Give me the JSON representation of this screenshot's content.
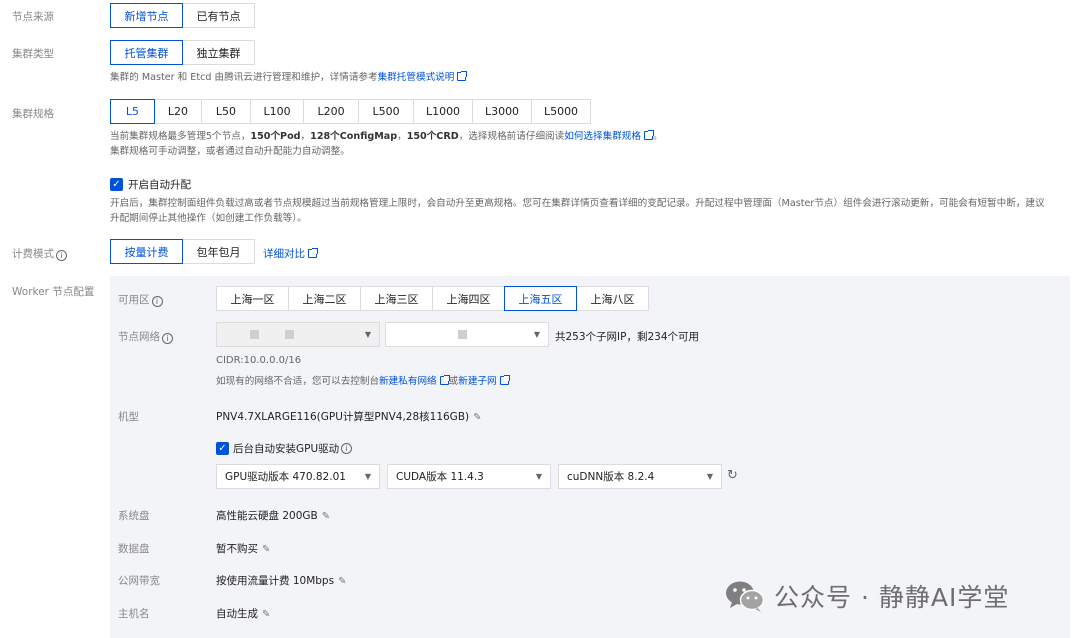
{
  "node_source": {
    "label": "节点来源",
    "options": [
      "新增节点",
      "已有节点"
    ],
    "selected": 0
  },
  "cluster_type": {
    "label": "集群类型",
    "options": [
      "托管集群",
      "独立集群"
    ],
    "selected": 0,
    "tip_prefix": "集群的 Master 和 Etcd 由腾讯云进行管理和维护，详情请参考",
    "tip_link": "集群托管模式说明"
  },
  "cluster_spec": {
    "label": "集群规格",
    "options": [
      "L5",
      "L20",
      "L50",
      "L100",
      "L200",
      "L500",
      "L1000",
      "L3000",
      "L5000"
    ],
    "selected": 0,
    "tip1_a": "当前集群规格最多管理5个节点，",
    "tip1_b1": "150个Pod",
    "tip1_sep1": "，",
    "tip1_b2": "128个ConfigMap",
    "tip1_sep2": "，",
    "tip1_b3": "150个CRD",
    "tip1_c": "，选择规格前请仔细阅读",
    "tip1_link": "如何选择集群规格",
    "tip1_end": "。",
    "tip2": "集群规格可手动调整，或者通过自动升配能力自动调整。",
    "auto_upgrade_label": "开启自动升配",
    "auto_upgrade_desc1": "开启后，集群控制面组件负载过高或者节点规模超过当前规格管理上限时，会自动升至更高规格。您可在集群详情页查看详细的变配记录。升配过程中管理面（Master节点）组件会进行滚动更新，可能会有短暂中断，建议",
    "auto_upgrade_desc2": "升配期间停止其他操作（如创建工作负载等）。"
  },
  "billing": {
    "label": "计费模式",
    "options": [
      "按量计费",
      "包年包月"
    ],
    "selected": 0,
    "compare_link": "详细对比"
  },
  "worker": {
    "label": "Worker 节点配置",
    "zone": {
      "label": "可用区",
      "options": [
        "上海一区",
        "上海二区",
        "上海三区",
        "上海四区",
        "上海五区",
        "上海八区"
      ],
      "selected": 4
    },
    "network": {
      "label": "节点网络",
      "subnet_info": "共253个子网IP，剩234个可用",
      "cidr": "CIDR:10.0.0.0/16",
      "hint_prefix": "如现有的网络不合适，您可以去控制台",
      "link_vpc": "新建私有网络",
      "hint_or": "或",
      "link_subnet": "新建子网"
    },
    "model": {
      "label": "机型",
      "value": "PNV4.7XLARGE116(GPU计算型PNV4,28核116GB)"
    },
    "gpu": {
      "auto_install_label": "后台自动安装GPU驱动",
      "driver": "GPU驱动版本 470.82.01",
      "cuda": "CUDA版本 11.4.3",
      "cudnn": "cuDNN版本 8.2.4"
    },
    "system_disk": {
      "label": "系统盘",
      "value": "高性能云硬盘 200GB"
    },
    "data_disk": {
      "label": "数据盘",
      "value": "暂不购买"
    },
    "bandwidth": {
      "label": "公网带宽",
      "value": "按使用流量计费 10Mbps"
    },
    "hostname": {
      "label": "主机名",
      "value": "自动生成"
    }
  },
  "watermark": {
    "text": "公众号 · 静静AI学堂"
  }
}
